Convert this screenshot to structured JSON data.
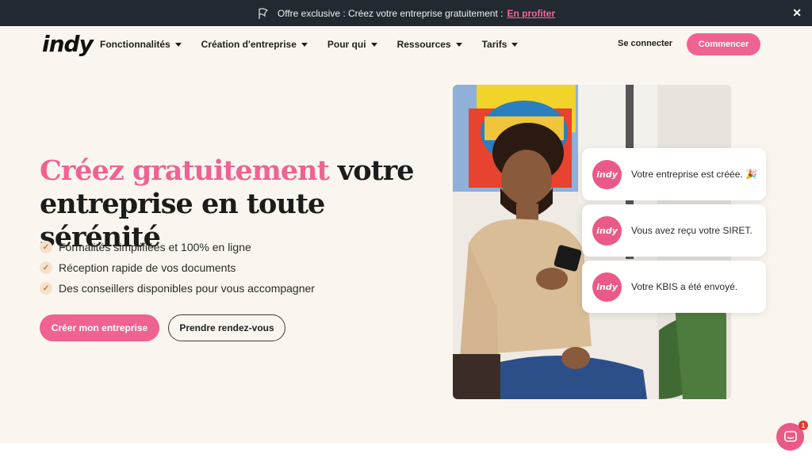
{
  "banner": {
    "text": "Offre exclusive : Créez votre entreprise gratuitement :",
    "cta": "En profiter",
    "icon": "flag-icon",
    "close": "✕"
  },
  "header": {
    "logo": "indy",
    "menu": [
      {
        "label": "Fonctionnalités"
      },
      {
        "label": "Création d'entreprise"
      },
      {
        "label": "Pour qui"
      },
      {
        "label": "Ressources"
      },
      {
        "label": "Tarifs"
      }
    ],
    "login": "Se connecter",
    "start": "Commencer"
  },
  "hero": {
    "title_accent": "Créez gratuitement",
    "title_rest_1": " votre",
    "title_rest_2": "entreprise en toute sérénité",
    "features": [
      "Formalités simplifiées et 100% en ligne",
      "Réception rapide de vos documents",
      "Des conseillers disponibles pour vous accompagner"
    ],
    "primary_cta": "Créer mon entreprise",
    "secondary_cta": "Prendre rendez-vous"
  },
  "notifications": [
    {
      "badge": "indy",
      "message": "Votre entreprise est créée. 🎉"
    },
    {
      "badge": "indy",
      "message": "Vous avez reçu votre SIRET."
    },
    {
      "badge": "indy",
      "message": "Votre KBIS a été envoyé."
    }
  ],
  "chat": {
    "unread": "1",
    "icon": "chat-icon"
  },
  "colors": {
    "accent": "#f06292",
    "banner_bg": "#232930",
    "page_bg": "#faf6ef"
  }
}
